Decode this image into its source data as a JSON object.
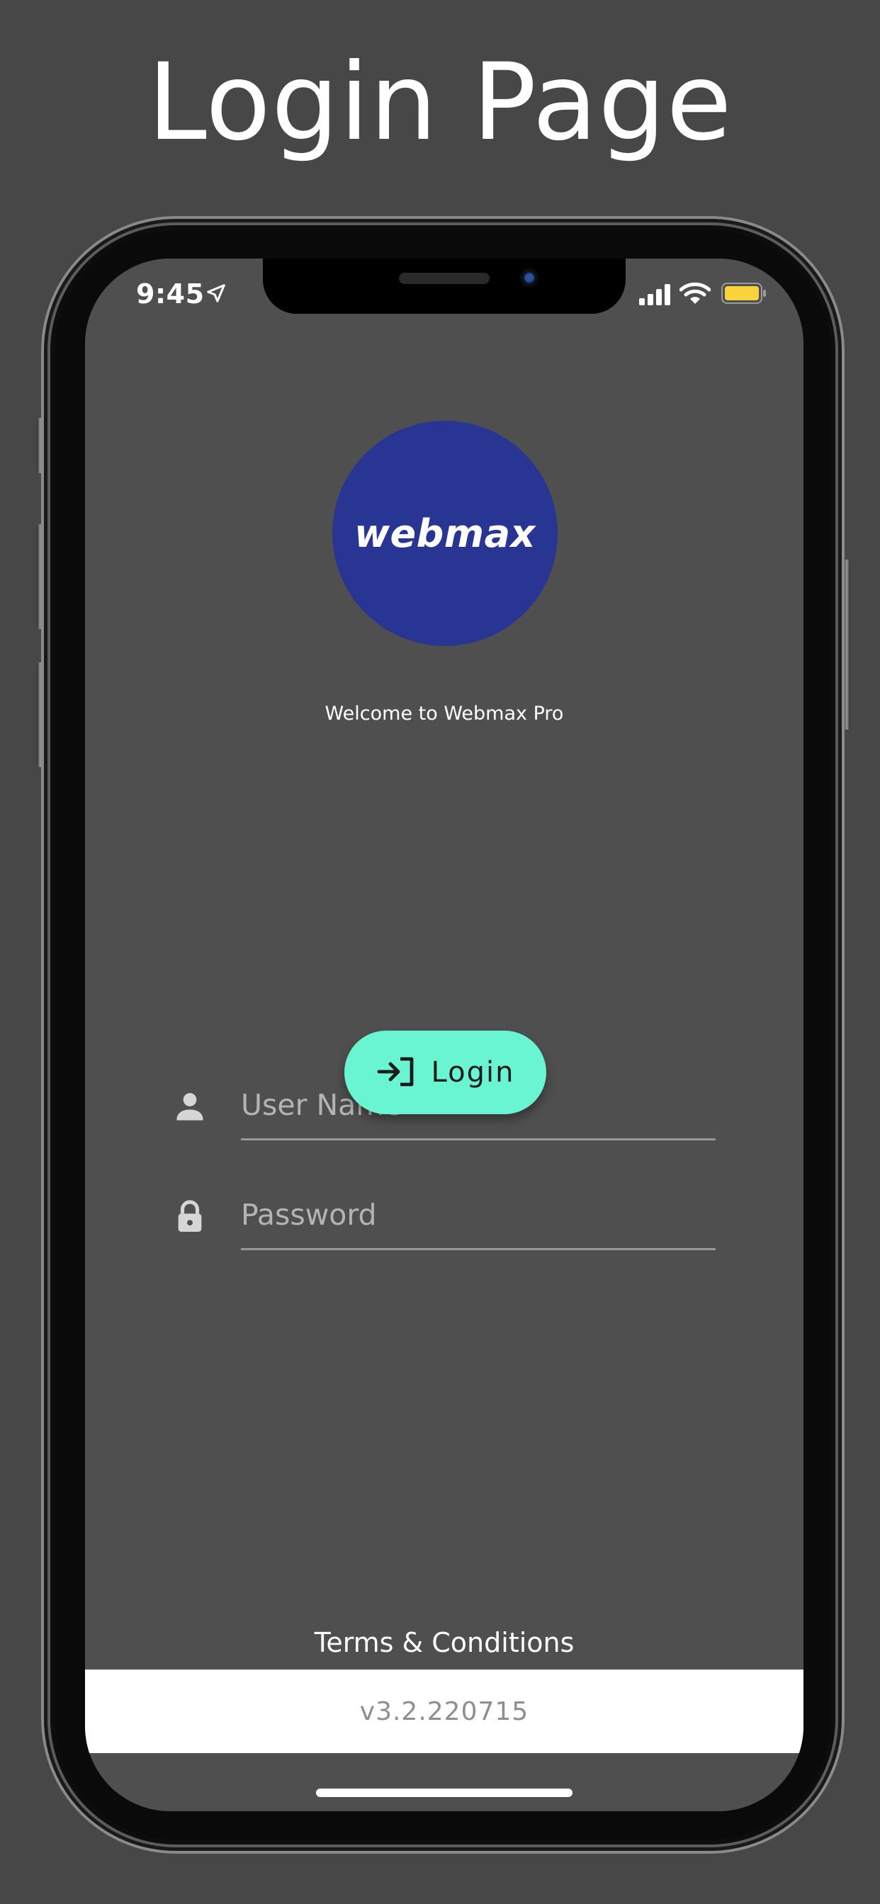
{
  "page": {
    "heading": "Login Page"
  },
  "status_bar": {
    "time": "9:45",
    "icons": [
      "location-arrow-icon",
      "cellular-signal-icon",
      "wifi-icon",
      "battery-icon"
    ],
    "battery_color": "#f9d23c"
  },
  "app": {
    "logo_text": "webmax",
    "logo_color": "#283593",
    "welcome_text": "Welcome to Webmax Pro",
    "username": {
      "placeholder": "User Name",
      "value": "",
      "icon": "person-icon"
    },
    "password": {
      "placeholder": "Password",
      "value": "",
      "icon": "lock-icon"
    },
    "login_button": {
      "label": "Login",
      "icon": "login-icon",
      "color": "#6af5d2"
    },
    "terms_link": "Terms & Conditions",
    "version": "v3.2.220715"
  }
}
